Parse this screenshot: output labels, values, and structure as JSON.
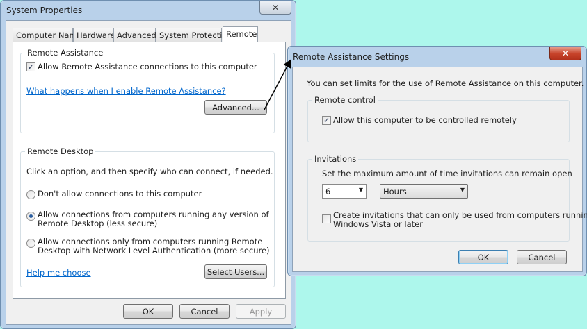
{
  "system_properties": {
    "title": "System Properties",
    "close_glyph": "✕",
    "tabs": [
      {
        "label": "Computer Name"
      },
      {
        "label": "Hardware"
      },
      {
        "label": "Advanced"
      },
      {
        "label": "System Protection"
      },
      {
        "label": "Remote"
      }
    ],
    "active_tab": "Remote",
    "remote_assistance": {
      "group_label": "Remote Assistance",
      "allow_label": "Allow Remote Assistance connections to this computer",
      "allow_checked": true,
      "help_link": "What happens when I enable Remote Assistance?",
      "advanced_button": "Advanced..."
    },
    "remote_desktop": {
      "group_label": "Remote Desktop",
      "instruction": "Click an option, and then specify who can connect, if needed.",
      "options": [
        {
          "label_line1": "Don't allow connections to this computer",
          "label_line2": "",
          "selected": false
        },
        {
          "label_line1": "Allow connections from computers running any version of",
          "label_line2": "Remote Desktop (less secure)",
          "selected": true
        },
        {
          "label_line1": "Allow connections only from computers running Remote",
          "label_line2": "Desktop with Network Level Authentication (more secure)",
          "selected": false
        }
      ],
      "help_link": "Help me choose",
      "select_users_button": "Select Users..."
    },
    "buttons": {
      "ok": "OK",
      "cancel": "Cancel",
      "apply": "Apply"
    }
  },
  "remote_assistance_settings": {
    "title": "Remote Assistance Settings",
    "close_glyph": "✕",
    "intro": "You can set limits for the use of Remote Assistance on this computer.",
    "remote_control": {
      "group_label": "Remote control",
      "allow_label": "Allow this computer to be controlled remotely",
      "allow_checked": true
    },
    "invitations": {
      "group_label": "Invitations",
      "instruction": "Set the maximum amount of time invitations can remain open",
      "amount_value": "6",
      "unit_value": "Hours",
      "vista_label_line1": "Create invitations that can only be used from computers running",
      "vista_label_line2": "Windows Vista or later",
      "vista_checked": false
    },
    "buttons": {
      "ok": "OK",
      "cancel": "Cancel"
    }
  },
  "glyphs": {
    "check": "✓",
    "dropdown": "▼"
  },
  "colors": {
    "desktop": "#adf7ec",
    "frame": "#b9d1ea",
    "link": "#0066cc",
    "close_red": "#c7432a"
  }
}
